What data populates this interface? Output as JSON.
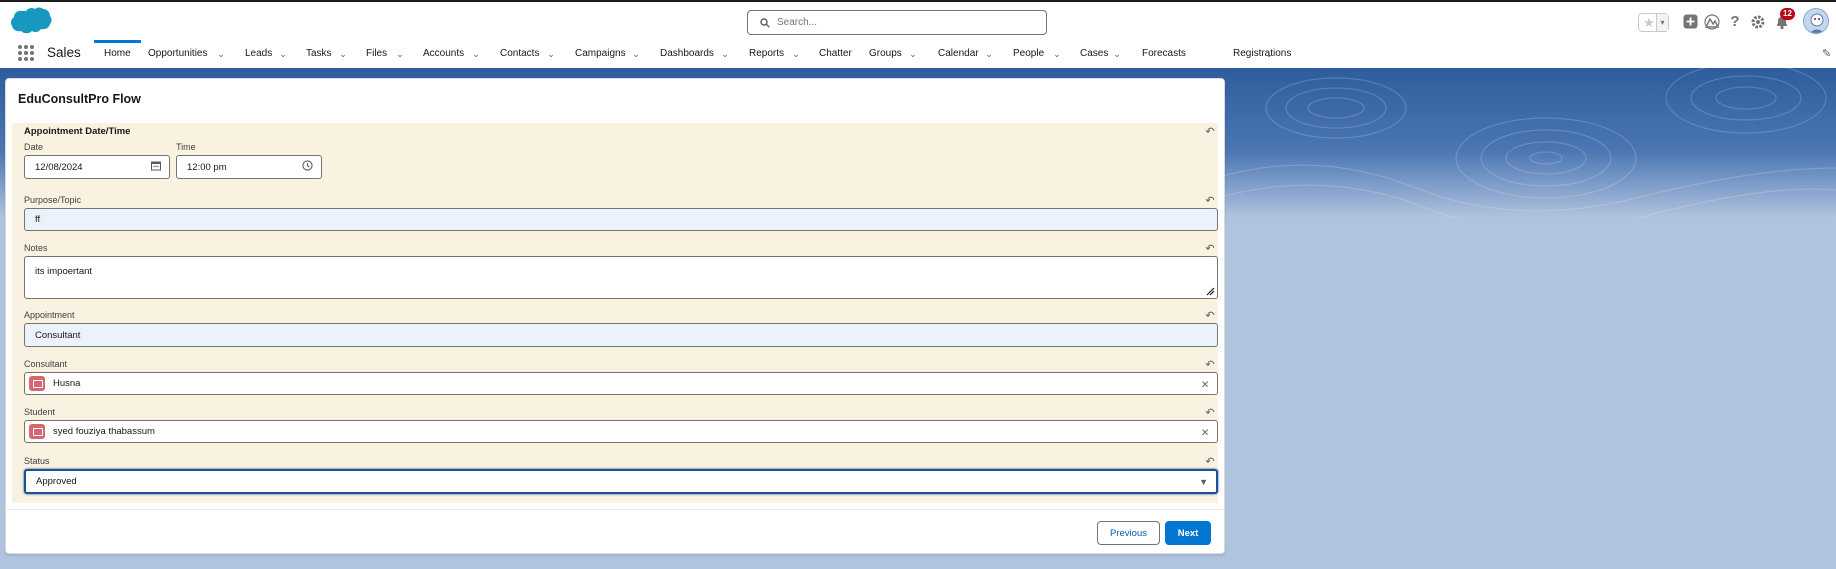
{
  "header": {
    "search_placeholder": "Search...",
    "notification_count": "12",
    "icons": [
      "favorites-star-icon",
      "favorites-dropdown-icon",
      "global-actions-add-icon",
      "trailhead-guidance-icon",
      "help-icon",
      "setup-gear-icon",
      "notifications-bell-icon",
      "user-avatar"
    ]
  },
  "nav": {
    "app_name": "Sales",
    "items": [
      {
        "label": "Home",
        "active": true,
        "dropdown": false
      },
      {
        "label": "Opportunities",
        "dropdown": true
      },
      {
        "label": "Leads",
        "dropdown": true
      },
      {
        "label": "Tasks",
        "dropdown": true
      },
      {
        "label": "Files",
        "dropdown": true
      },
      {
        "label": "Accounts",
        "dropdown": true
      },
      {
        "label": "Contacts",
        "dropdown": true
      },
      {
        "label": "Campaigns",
        "dropdown": true
      },
      {
        "label": "Dashboards",
        "dropdown": true
      },
      {
        "label": "Reports",
        "dropdown": true
      },
      {
        "label": "Chatter",
        "dropdown": false
      },
      {
        "label": "Groups",
        "dropdown": true
      },
      {
        "label": "Calendar",
        "dropdown": true
      },
      {
        "label": "People",
        "dropdown": true
      },
      {
        "label": "Cases",
        "dropdown": true
      },
      {
        "label": "Forecasts",
        "dropdown": false
      },
      {
        "label": "Registrations",
        "dropdown": true
      }
    ]
  },
  "flow": {
    "title": "EduConsultPro Flow",
    "section_label": "Appointment Date/Time",
    "date_label": "Date",
    "date_value": "12/08/2024",
    "time_label": "Time",
    "time_value": "12:00 pm",
    "purpose_label": "Purpose/Topic",
    "purpose_value": "ff",
    "notes_label": "Notes",
    "notes_value": "its impoertant",
    "appointment_label": "Appointment",
    "appointment_value": "Consultant",
    "consultant_label": "Consultant",
    "consultant_value": "Husna",
    "student_label": "Student",
    "student_value": "syed fouziya thabassum",
    "status_label": "Status",
    "status_value": "Approved",
    "previous_label": "Previous",
    "next_label": "Next"
  },
  "colors": {
    "brand_blue": "#0176d3",
    "form_background": "#faf2e1",
    "lookup_icon": "#d3696e",
    "badge": "#ba0517"
  }
}
